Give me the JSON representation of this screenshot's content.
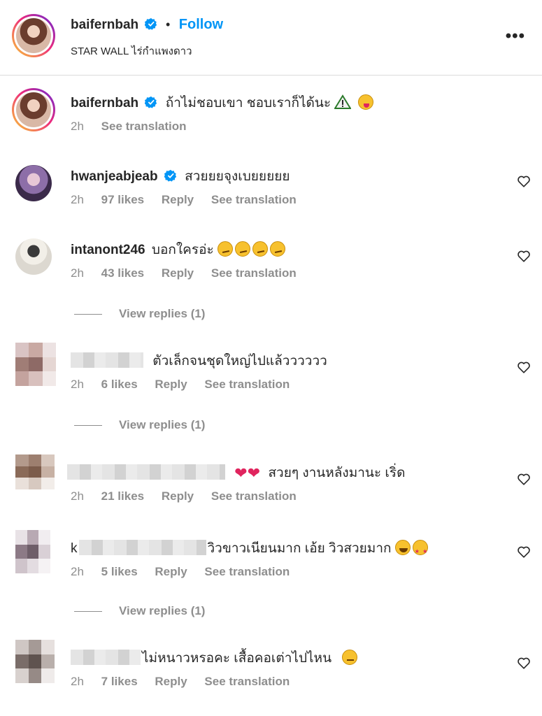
{
  "post": {
    "author": "baifernbah",
    "follow_label": "Follow",
    "separator": "•",
    "location": "STAR WALL ไร่กำแพงดาว",
    "more_label": "•••"
  },
  "comments": [
    {
      "username": "baifernbah",
      "text": "ถ้าไม่ชอบเขา ชอบเราก็ได้นะ",
      "time": "2h",
      "see_translation": "See translation"
    },
    {
      "username": "hwanjeabjeab",
      "text": "สวยยยจุงเบยยยยย",
      "time": "2h",
      "likes": "97 likes",
      "reply": "Reply",
      "see_translation": "See translation"
    },
    {
      "username": "intanont246",
      "text": "บอกใครอ่ะ",
      "time": "2h",
      "likes": "43 likes",
      "reply": "Reply",
      "see_translation": "See translation",
      "view_replies": "View replies (1)"
    },
    {
      "text": "ตัวเล็กจนชุดใหญ่ไปแล้วววววว",
      "time": "2h",
      "likes": "6 likes",
      "reply": "Reply",
      "see_translation": "See translation",
      "view_replies": "View replies (1)"
    },
    {
      "text": "สวยๆ งานหลังมานะ เริ่ด",
      "time": "2h",
      "likes": "21 likes",
      "reply": "Reply",
      "see_translation": "See translation"
    },
    {
      "name_prefix": "k",
      "text": "วิวขาวเนียนมาก เอ้ย วิวสวยมาก",
      "time": "2h",
      "likes": "5 likes",
      "reply": "Reply",
      "see_translation": "See translation",
      "view_replies": "View replies (1)"
    },
    {
      "text": "ไม่หนาวหรอคะ เสื้อคอเต่าไปไหน",
      "time": "2h",
      "likes": "7 likes",
      "reply": "Reply",
      "see_translation": "See translation"
    }
  ],
  "colors": {
    "link": "#0095f6",
    "muted": "#8e8e8e",
    "text": "#262626",
    "verified": "#0095f6",
    "heart_red": "#e0245e"
  },
  "icons": {
    "verified": "verified-badge-icon",
    "like": "heart-outline-icon",
    "more": "more-options-icon"
  }
}
